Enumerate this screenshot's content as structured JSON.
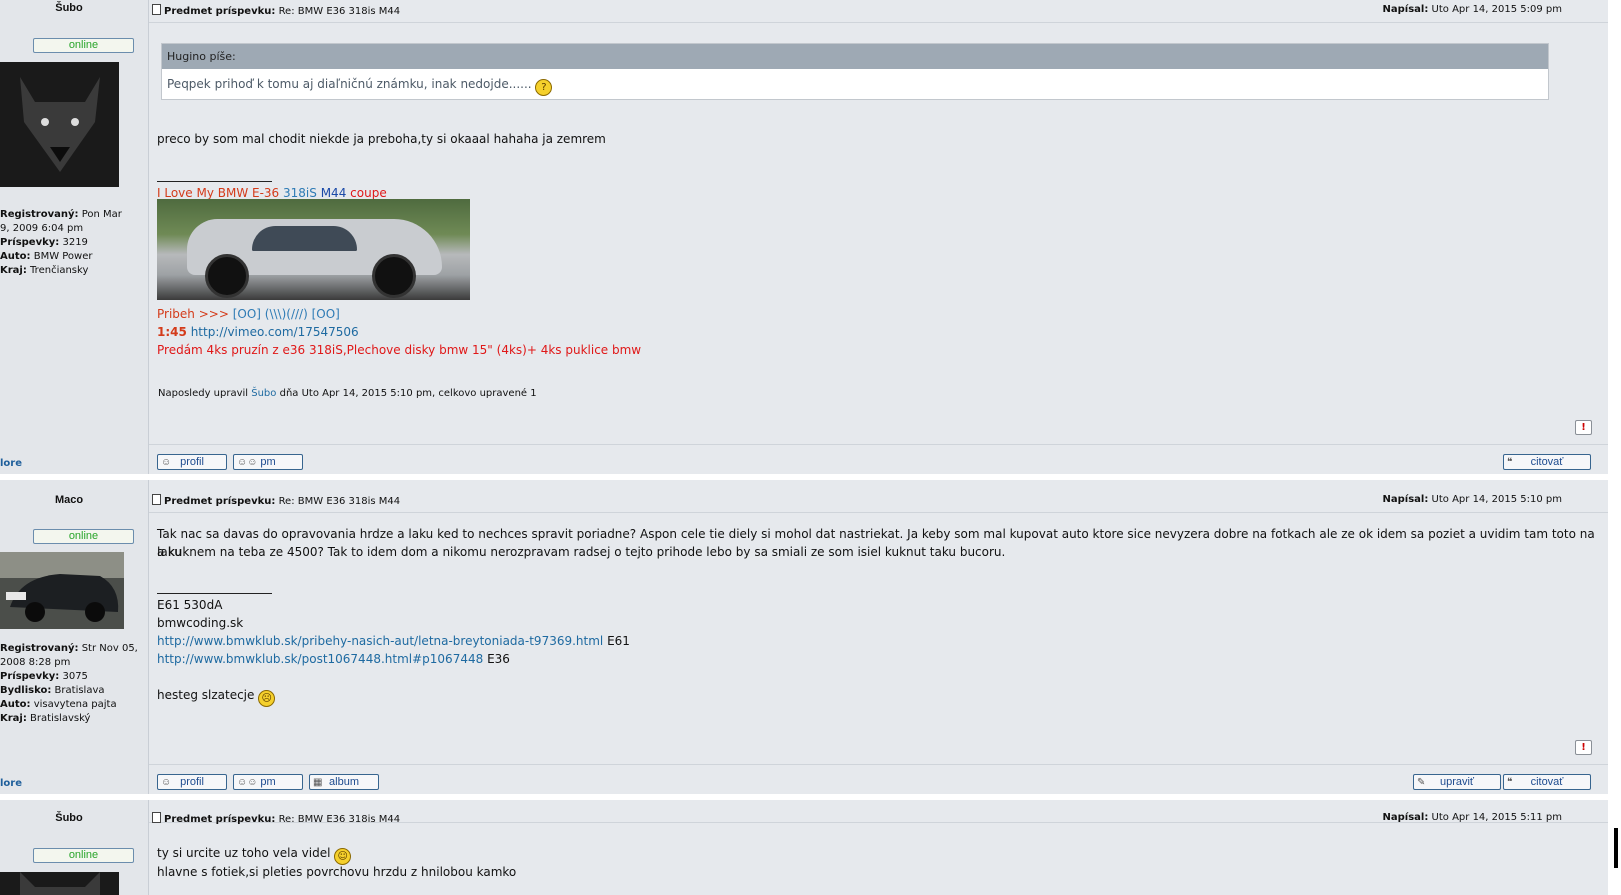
{
  "posts": [
    {
      "author": "Šubo",
      "status": "online",
      "profile": [
        {
          "label": "Registrovaný:",
          "value": "Pon Mar"
        },
        {
          "label": "",
          "value": "9, 2009 6:04 pm"
        },
        {
          "label": "Príspevky:",
          "value": "3219"
        },
        {
          "label": "Auto:",
          "value": "BMW Power"
        },
        {
          "label": "Kraj:",
          "value": "Trenčiansky"
        }
      ],
      "more": "lore",
      "subject_label": "Predmet príspevku:",
      "subject": "Re: BMW E36 318is M44",
      "posted_label": "Napísal:",
      "posted": "Uto Apr 14, 2015 5:09 pm",
      "quote_author": "Hugino píše:",
      "quote_text": "Peqpek prihoď k tomu aj diaľničnú známku, inak nedojde......",
      "body": "preco by som mal chodit niekde ja preboha,ty si okaaal hahaha ja zemrem",
      "sig_line1": {
        "a": "I Love My BMW E-36",
        "b": "318iS",
        "c": "M44",
        "d": "coupe"
      },
      "sig_line2": {
        "a": "Pribeh >>>",
        "b": "[OO] (\\\\\\)(///) [OO]"
      },
      "sig_line3": {
        "a": "1:45",
        "b": "http://vimeo.com/17547506"
      },
      "sig_line4": "Predám 4ks pruzín z e36 318iS,Plechove disky bmw 15\" (4ks)+ 4ks puklice bmw",
      "edited_prefix": "Naposledy upravil",
      "edited_user": "Šubo",
      "edited_suffix": "dňa Uto Apr 14, 2015 5:10 pm, celkovo upravené 1",
      "buttons": {
        "profile": "profil",
        "pm": "pm",
        "quote": "citovať"
      }
    },
    {
      "author": "Maco",
      "status": "online",
      "profile": [
        {
          "label": "Registrovaný:",
          "value": "Str Nov 05,"
        },
        {
          "label": "",
          "value": "2008 8:28 pm"
        },
        {
          "label": "Príspevky:",
          "value": "3075"
        },
        {
          "label": "Bydlisko:",
          "value": "Bratislava"
        },
        {
          "label": "Auto:",
          "value": "visavytena pajta"
        },
        {
          "label": "Kraj:",
          "value": "Bratislavský"
        }
      ],
      "more": "lore",
      "subject_label": "Predmet príspevku:",
      "subject": "Re: BMW E36 318is M44",
      "posted_label": "Napísal:",
      "posted": "Uto Apr 14, 2015 5:10 pm",
      "body_line1": "Tak nac sa davas do opravovania hrdze a laku ked to nechces spravit poriadne? Aspon cele tie diely si mohol dat nastriekat. Ja keby som mal kupovat auto ktore sice nevyzera dobre na fotkach ale ze ok idem sa poziet a uvidim tam toto na laku",
      "body_line2": "a kuknem na teba ze 4500? Tak to idem dom a nikomu nerozpravam radsej o tejto prihode lebo by sa smiali ze som isiel kuknut taku bucoru.",
      "sig": [
        "E61 530dA",
        "bmwcoding.sk"
      ],
      "sig_link1": "http://www.bmwklub.sk/pribehy-nasich-aut/letna-breytoniada-t97369.html",
      "sig_link1_suffix": "E61",
      "sig_link2": "http://www.bmwklub.sk/post1067448.html#p1067448",
      "sig_link2_suffix": "E36",
      "sig_last": "hesteg slzatecje",
      "buttons": {
        "profile": "profil",
        "pm": "pm",
        "album": "album",
        "edit": "upraviť",
        "quote": "citovať"
      }
    },
    {
      "author": "Šubo",
      "status": "online",
      "subject_label": "Predmet príspevku:",
      "subject": "Re: BMW E36 318is M44",
      "posted_label": "Napísal:",
      "posted": "Uto Apr 14, 2015 5:11 pm",
      "body_line1": "ty si urcite uz toho vela videl",
      "body_line2": "hlavne s fotiek,si pleties povrchovu hrzdu z hnilobou kamko"
    }
  ],
  "icons": {
    "report": "report-icon",
    "post": "post-icon"
  },
  "colors": {
    "online": "#29a52b",
    "link": "#1e6aa1",
    "sig_red": "#d43b1a",
    "sig_alert": "#e01818"
  }
}
